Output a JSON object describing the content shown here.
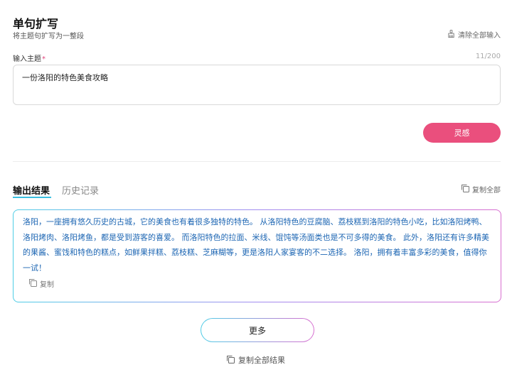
{
  "header": {
    "title": "单句扩写",
    "subtitle": "将主题句扩写为一整段",
    "clear_label": "清除全部输入"
  },
  "input": {
    "label": "输入主题",
    "required_mark": "*",
    "counter": "11/200",
    "value": "一份洛阳的特色美食攻略"
  },
  "actions": {
    "inspire_label": "灵感"
  },
  "tabs": {
    "output_label": "输出结果",
    "history_label": "历史记录",
    "copy_all_label": "复制全部"
  },
  "result": {
    "text": "洛阳，一座拥有悠久历史的古城，它的美食也有着很多独特的特色。 从洛阳特色的豆腐脑、荔枝糕到洛阳的特色小吃，比如洛阳烤鸭、洛阳烤肉、洛阳烤鱼，都是受到游客的喜爱。 而洛阳特色的拉面、米线、馄饨等汤面类也是不可多得的美食。 此外，洛阳还有许多精美的果酱、蜜饯和特色的糕点，如鲜果拌糕、荔枝糕、芝麻糊等，更是洛阳人家宴客的不二选择。 洛阳，拥有着丰富多彩的美食，值得你一试！",
    "copy_label": "复制"
  },
  "footer": {
    "more_label": "更多",
    "copy_all_results_label": "复制全部结果"
  },
  "icons": {
    "clear": "broom-icon",
    "copy": "copy-icon"
  },
  "colors": {
    "accent_pink": "#ea4f7d",
    "tab_underline": "#3bbfe0",
    "result_text": "#1d66b3",
    "gradient_start": "#4ecde6",
    "gradient_end": "#d86fd0"
  }
}
